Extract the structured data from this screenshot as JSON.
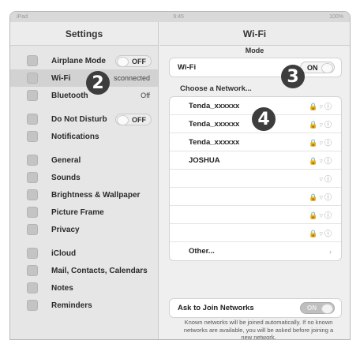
{
  "statusbar": {
    "left": "iPad",
    "center": "9:45",
    "right": "100%"
  },
  "settings": {
    "title": "Settings",
    "items": [
      {
        "label": "Airplane Mode",
        "toggle": "OFF"
      },
      {
        "label": "Wi-Fi",
        "value": "sconnected",
        "selected": true
      },
      {
        "label": "Bluetooth",
        "value": "Off"
      },
      {
        "label": "Do Not Disturb",
        "toggle": "OFF"
      },
      {
        "label": "Notifications"
      },
      {
        "label": "General"
      },
      {
        "label": "Sounds"
      },
      {
        "label": "Brightness & Wallpaper"
      },
      {
        "label": "Picture Frame"
      },
      {
        "label": "Privacy"
      },
      {
        "label": "iCloud"
      },
      {
        "label": "Mail, Contacts, Calendars"
      },
      {
        "label": "Notes"
      },
      {
        "label": "Reminders"
      }
    ]
  },
  "wifi": {
    "title": "Wi-Fi",
    "mode_label": "Mode",
    "wifi_row_label": "Wi-Fi",
    "wifi_toggle": "ON",
    "choose_label": "Choose a Network...",
    "networks": [
      {
        "name": "Tenda_xxxxxx"
      },
      {
        "name": "Tenda_xxxxxx"
      },
      {
        "name": "Tenda_xxxxxx"
      },
      {
        "name": "JOSHUA"
      },
      {
        "name": ""
      },
      {
        "name": ""
      },
      {
        "name": ""
      },
      {
        "name": ""
      }
    ],
    "other_label": "Other...",
    "ask_label": "Ask to Join Networks",
    "ask_toggle": "ON",
    "footnote": "Known networks will be joined automatically. If no known networks are available, you will be asked before joining a new network."
  },
  "callouts": [
    "2",
    "3",
    "4"
  ]
}
